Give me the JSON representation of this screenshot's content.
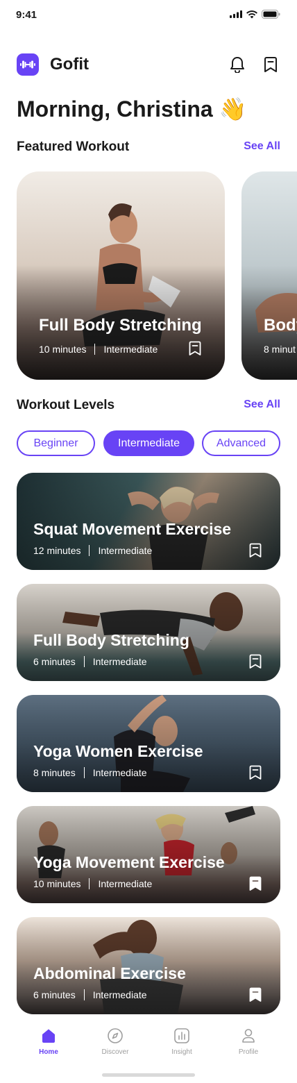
{
  "status_bar": {
    "time": "9:41"
  },
  "header": {
    "app_name": "Gofit",
    "greeting": "Morning, Christina 👋"
  },
  "featured": {
    "section_title": "Featured Workout",
    "see_all": "See All",
    "cards": [
      {
        "title": "Full Body Stretching",
        "duration": "10 minutes",
        "level": "Intermediate"
      },
      {
        "title": "Body",
        "duration": "8 minut",
        "level": ""
      }
    ]
  },
  "levels": {
    "section_title": "Workout Levels",
    "see_all": "See All",
    "pills": [
      "Beginner",
      "Intermediate",
      "Advanced"
    ],
    "selected": "Intermediate"
  },
  "workouts": [
    {
      "title": "Squat Movement Exercise",
      "duration": "12 minutes",
      "level": "Intermediate",
      "bookmarked": false
    },
    {
      "title": "Full Body Stretching",
      "duration": "6 minutes",
      "level": "Intermediate",
      "bookmarked": false
    },
    {
      "title": "Yoga Women Exercise",
      "duration": "8 minutes",
      "level": "Intermediate",
      "bookmarked": false
    },
    {
      "title": "Yoga Movement Exercise",
      "duration": "10 minutes",
      "level": "Intermediate",
      "bookmarked": true
    },
    {
      "title": "Abdominal Exercise",
      "duration": "6 minutes",
      "level": "Intermediate",
      "bookmarked": true
    }
  ],
  "nav": {
    "items": [
      {
        "label": "Home",
        "icon": "home-icon",
        "active": true
      },
      {
        "label": "Discover",
        "icon": "compass-icon",
        "active": false
      },
      {
        "label": "Insight",
        "icon": "chart-icon",
        "active": false
      },
      {
        "label": "Profile",
        "icon": "user-icon",
        "active": false
      }
    ]
  },
  "colors": {
    "accent": "#6843f5",
    "text": "#1a1a1a",
    "inactive": "#9e9e9e"
  }
}
